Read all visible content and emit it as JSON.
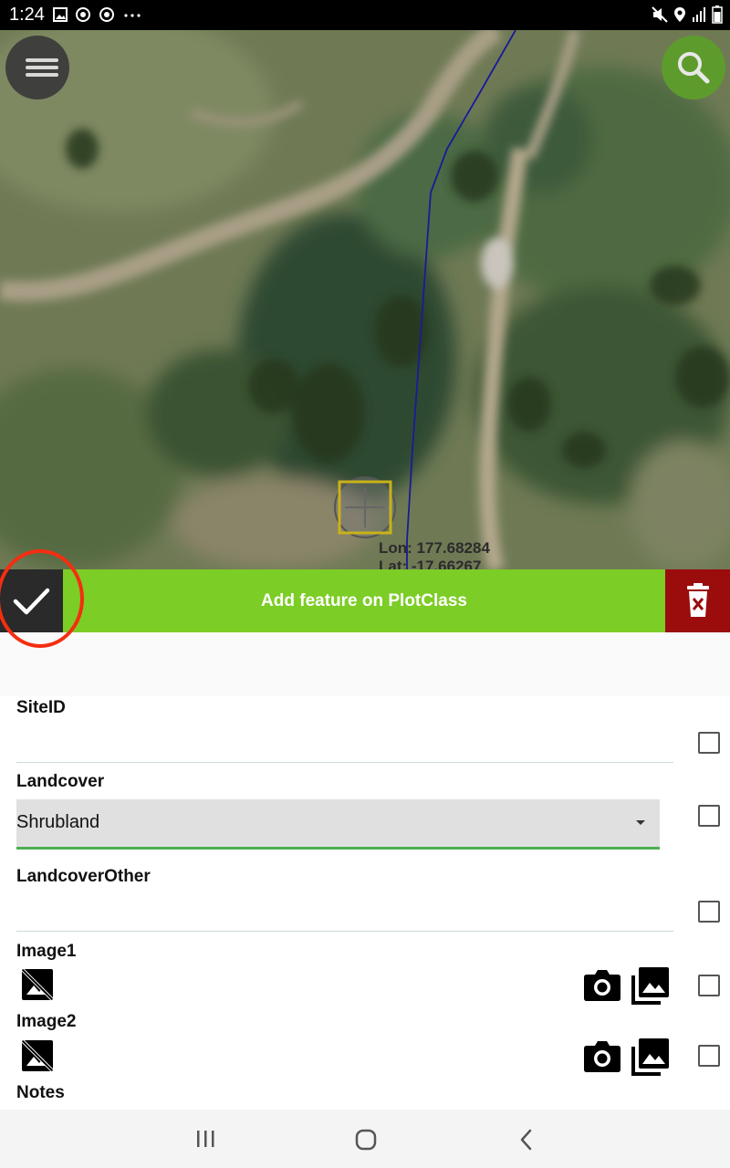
{
  "status_bar": {
    "time": "1:24",
    "left_icons": [
      "image-icon",
      "sync-icon",
      "sync-icon",
      "more-dots-icon"
    ],
    "right_icons": [
      "mute-icon",
      "location-icon",
      "signal-icon",
      "battery-icon"
    ]
  },
  "map": {
    "coords_line1": "Lon: 177.68284",
    "coords_line2": "Lat: -17.66267",
    "route_color": "#1a1a9a"
  },
  "toolbar": {
    "title": "Add feature on PlotClass",
    "accent": "#7ccd26",
    "delete_color": "#9b0c0c"
  },
  "form": {
    "fields": [
      {
        "label": "SiteID",
        "value": ""
      },
      {
        "label": "Landcover",
        "value": "Shrubland"
      },
      {
        "label": "LandcoverOther",
        "value": ""
      },
      {
        "label": "Image1"
      },
      {
        "label": "Image2"
      },
      {
        "label": "Notes"
      }
    ]
  },
  "nav_bar": {
    "buttons": [
      "recent-apps-icon",
      "home-icon",
      "back-icon"
    ]
  }
}
